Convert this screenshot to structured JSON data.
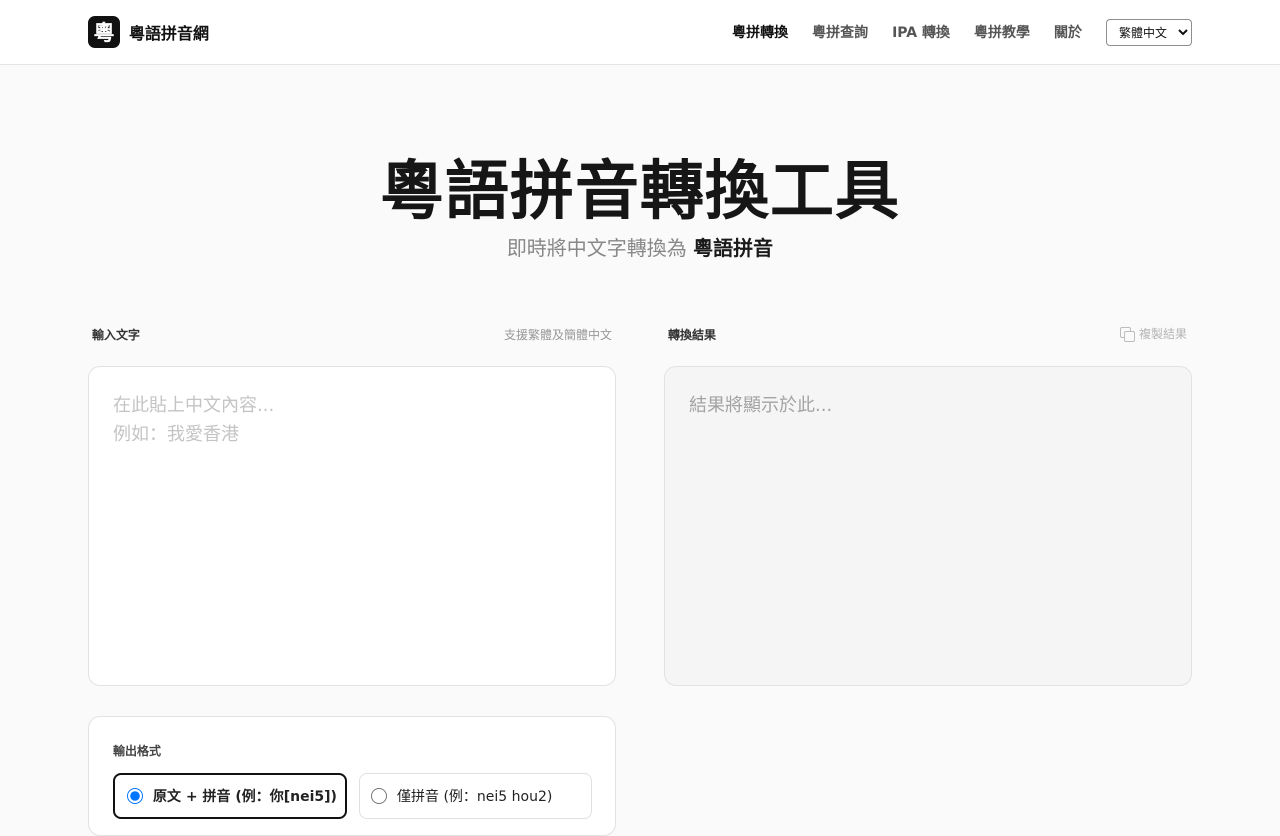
{
  "header": {
    "logo_glyph": "粵",
    "site_name": "粵語拼音網",
    "nav": [
      {
        "label": "粵拼轉換",
        "active": true
      },
      {
        "label": "粵拼查詢",
        "active": false
      },
      {
        "label": "IPA 轉換",
        "active": false
      },
      {
        "label": "粵拼教學",
        "active": false
      },
      {
        "label": "關於",
        "active": false
      }
    ],
    "language_select": {
      "selected": "繁體中文"
    }
  },
  "hero": {
    "title": "粵語拼音轉換工具",
    "subtitle_prefix": "即時將中文字轉換為",
    "subtitle_emphasis": "粵語拼音"
  },
  "input_panel": {
    "label": "輸入文字",
    "hint": "支援繁體及簡體中文",
    "placeholder": "在此貼上中文內容...\n例如：我愛香港",
    "value": ""
  },
  "output_panel": {
    "label": "轉換結果",
    "copy_label": "複製結果",
    "placeholder": "結果將顯示於此..."
  },
  "format_options": {
    "title": "輸出格式",
    "options": [
      {
        "label": "原文 + 拼音 (例：你[nei5])",
        "selected": true
      },
      {
        "label": "僅拼音 (例：nei5 hou2)",
        "selected": false
      }
    ]
  },
  "colors": {
    "accent": "#111111",
    "page_background": "#fafafa",
    "border": "#e2e2e2"
  }
}
